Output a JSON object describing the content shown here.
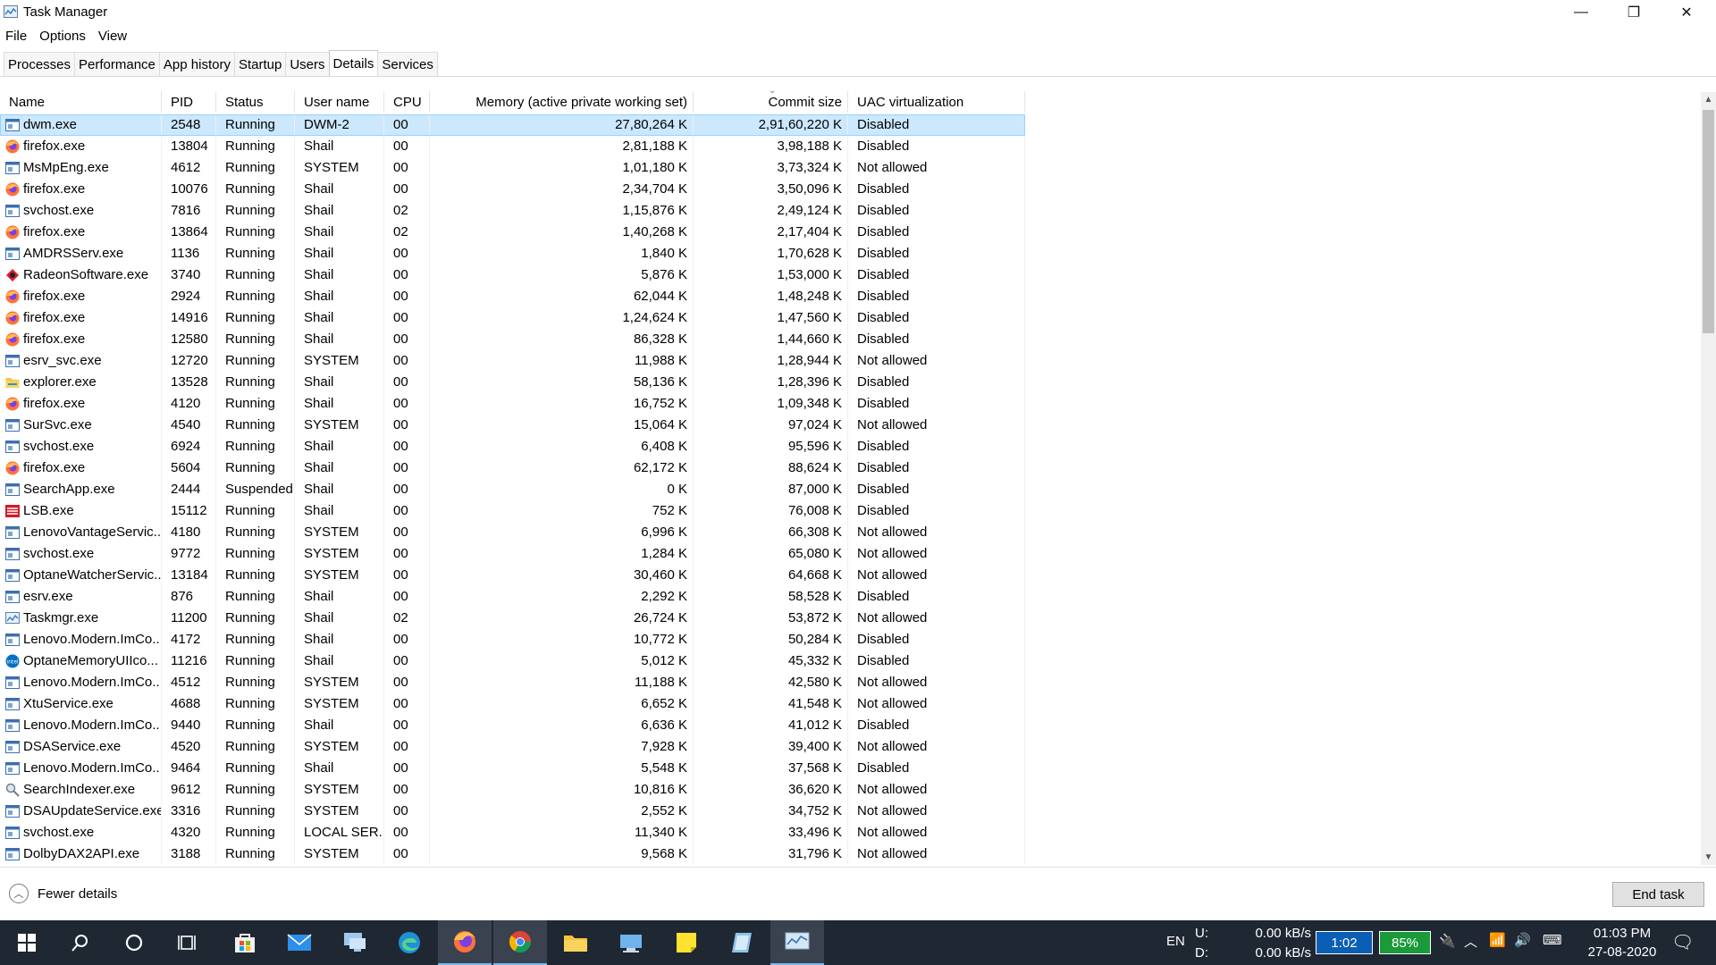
{
  "window": {
    "title": "Task Manager",
    "minimize": "—",
    "restore": "❐",
    "close": "✕"
  },
  "menu": [
    "File",
    "Options",
    "View"
  ],
  "tabs": [
    {
      "label": "Processes",
      "active": false
    },
    {
      "label": "Performance",
      "active": false
    },
    {
      "label": "App history",
      "active": false
    },
    {
      "label": "Startup",
      "active": false
    },
    {
      "label": "Users",
      "active": false
    },
    {
      "label": "Details",
      "active": true
    },
    {
      "label": "Services",
      "active": false
    }
  ],
  "columns": {
    "name": "Name",
    "pid": "PID",
    "status": "Status",
    "user": "User name",
    "cpu": "CPU",
    "memory": "Memory (active private working set)",
    "commit": "Commit size",
    "uac": "UAC virtualization"
  },
  "rows": [
    {
      "name": "dwm.exe",
      "icon": "generic",
      "pid": "2548",
      "status": "Running",
      "user": "DWM-2",
      "cpu": "00",
      "memory": "27,80,264 K",
      "commit": "2,91,60,220 K",
      "uac": "Disabled",
      "selected": true
    },
    {
      "name": "firefox.exe",
      "icon": "firefox",
      "pid": "13804",
      "status": "Running",
      "user": "Shail",
      "cpu": "00",
      "memory": "2,81,188 K",
      "commit": "3,98,188 K",
      "uac": "Disabled"
    },
    {
      "name": "MsMpEng.exe",
      "icon": "generic",
      "pid": "4612",
      "status": "Running",
      "user": "SYSTEM",
      "cpu": "00",
      "memory": "1,01,180 K",
      "commit": "3,73,324 K",
      "uac": "Not allowed"
    },
    {
      "name": "firefox.exe",
      "icon": "firefox",
      "pid": "10076",
      "status": "Running",
      "user": "Shail",
      "cpu": "00",
      "memory": "2,34,704 K",
      "commit": "3,50,096 K",
      "uac": "Disabled"
    },
    {
      "name": "svchost.exe",
      "icon": "generic",
      "pid": "7816",
      "status": "Running",
      "user": "Shail",
      "cpu": "02",
      "memory": "1,15,876 K",
      "commit": "2,49,124 K",
      "uac": "Disabled"
    },
    {
      "name": "firefox.exe",
      "icon": "firefox",
      "pid": "13864",
      "status": "Running",
      "user": "Shail",
      "cpu": "02",
      "memory": "1,40,268 K",
      "commit": "2,17,404 K",
      "uac": "Disabled"
    },
    {
      "name": "AMDRSServ.exe",
      "icon": "generic",
      "pid": "1136",
      "status": "Running",
      "user": "Shail",
      "cpu": "00",
      "memory": "1,840 K",
      "commit": "1,70,628 K",
      "uac": "Disabled"
    },
    {
      "name": "RadeonSoftware.exe",
      "icon": "radeon",
      "pid": "3740",
      "status": "Running",
      "user": "Shail",
      "cpu": "00",
      "memory": "5,876 K",
      "commit": "1,53,000 K",
      "uac": "Disabled"
    },
    {
      "name": "firefox.exe",
      "icon": "firefox",
      "pid": "2924",
      "status": "Running",
      "user": "Shail",
      "cpu": "00",
      "memory": "62,044 K",
      "commit": "1,48,248 K",
      "uac": "Disabled"
    },
    {
      "name": "firefox.exe",
      "icon": "firefox",
      "pid": "14916",
      "status": "Running",
      "user": "Shail",
      "cpu": "00",
      "memory": "1,24,624 K",
      "commit": "1,47,560 K",
      "uac": "Disabled"
    },
    {
      "name": "firefox.exe",
      "icon": "firefox",
      "pid": "12580",
      "status": "Running",
      "user": "Shail",
      "cpu": "00",
      "memory": "86,328 K",
      "commit": "1,44,660 K",
      "uac": "Disabled"
    },
    {
      "name": "esrv_svc.exe",
      "icon": "generic",
      "pid": "12720",
      "status": "Running",
      "user": "SYSTEM",
      "cpu": "00",
      "memory": "11,988 K",
      "commit": "1,28,944 K",
      "uac": "Not allowed"
    },
    {
      "name": "explorer.exe",
      "icon": "explorer",
      "pid": "13528",
      "status": "Running",
      "user": "Shail",
      "cpu": "00",
      "memory": "58,136 K",
      "commit": "1,28,396 K",
      "uac": "Disabled"
    },
    {
      "name": "firefox.exe",
      "icon": "firefox",
      "pid": "4120",
      "status": "Running",
      "user": "Shail",
      "cpu": "00",
      "memory": "16,752 K",
      "commit": "1,09,348 K",
      "uac": "Disabled"
    },
    {
      "name": "SurSvc.exe",
      "icon": "generic",
      "pid": "4540",
      "status": "Running",
      "user": "SYSTEM",
      "cpu": "00",
      "memory": "15,064 K",
      "commit": "97,024 K",
      "uac": "Not allowed"
    },
    {
      "name": "svchost.exe",
      "icon": "generic",
      "pid": "6924",
      "status": "Running",
      "user": "Shail",
      "cpu": "00",
      "memory": "6,408 K",
      "commit": "95,596 K",
      "uac": "Disabled"
    },
    {
      "name": "firefox.exe",
      "icon": "firefox",
      "pid": "5604",
      "status": "Running",
      "user": "Shail",
      "cpu": "00",
      "memory": "62,172 K",
      "commit": "88,624 K",
      "uac": "Disabled"
    },
    {
      "name": "SearchApp.exe",
      "icon": "generic",
      "pid": "2444",
      "status": "Suspended",
      "user": "Shail",
      "cpu": "00",
      "memory": "0 K",
      "commit": "87,000 K",
      "uac": "Disabled"
    },
    {
      "name": "LSB.exe",
      "icon": "lsb",
      "pid": "15112",
      "status": "Running",
      "user": "Shail",
      "cpu": "00",
      "memory": "752 K",
      "commit": "76,008 K",
      "uac": "Disabled"
    },
    {
      "name": "LenovoVantageServic...",
      "icon": "generic",
      "pid": "4180",
      "status": "Running",
      "user": "SYSTEM",
      "cpu": "00",
      "memory": "6,996 K",
      "commit": "66,308 K",
      "uac": "Not allowed"
    },
    {
      "name": "svchost.exe",
      "icon": "generic",
      "pid": "9772",
      "status": "Running",
      "user": "SYSTEM",
      "cpu": "00",
      "memory": "1,284 K",
      "commit": "65,080 K",
      "uac": "Not allowed"
    },
    {
      "name": "OptaneWatcherServic...",
      "icon": "generic",
      "pid": "13184",
      "status": "Running",
      "user": "SYSTEM",
      "cpu": "00",
      "memory": "30,460 K",
      "commit": "64,668 K",
      "uac": "Not allowed"
    },
    {
      "name": "esrv.exe",
      "icon": "generic",
      "pid": "876",
      "status": "Running",
      "user": "Shail",
      "cpu": "00",
      "memory": "2,292 K",
      "commit": "58,528 K",
      "uac": "Disabled"
    },
    {
      "name": "Taskmgr.exe",
      "icon": "taskmgr",
      "pid": "11200",
      "status": "Running",
      "user": "Shail",
      "cpu": "02",
      "memory": "26,724 K",
      "commit": "53,872 K",
      "uac": "Not allowed"
    },
    {
      "name": "Lenovo.Modern.ImCo...",
      "icon": "generic",
      "pid": "4172",
      "status": "Running",
      "user": "Shail",
      "cpu": "00",
      "memory": "10,772 K",
      "commit": "50,284 K",
      "uac": "Disabled"
    },
    {
      "name": "OptaneMemoryUIIco...",
      "icon": "intel",
      "pid": "11216",
      "status": "Running",
      "user": "Shail",
      "cpu": "00",
      "memory": "5,012 K",
      "commit": "45,332 K",
      "uac": "Disabled"
    },
    {
      "name": "Lenovo.Modern.ImCo...",
      "icon": "generic",
      "pid": "4512",
      "status": "Running",
      "user": "SYSTEM",
      "cpu": "00",
      "memory": "11,188 K",
      "commit": "42,580 K",
      "uac": "Not allowed"
    },
    {
      "name": "XtuService.exe",
      "icon": "generic",
      "pid": "4688",
      "status": "Running",
      "user": "SYSTEM",
      "cpu": "00",
      "memory": "6,652 K",
      "commit": "41,548 K",
      "uac": "Not allowed"
    },
    {
      "name": "Lenovo.Modern.ImCo...",
      "icon": "generic",
      "pid": "9440",
      "status": "Running",
      "user": "Shail",
      "cpu": "00",
      "memory": "6,636 K",
      "commit": "41,012 K",
      "uac": "Disabled"
    },
    {
      "name": "DSAService.exe",
      "icon": "generic",
      "pid": "4520",
      "status": "Running",
      "user": "SYSTEM",
      "cpu": "00",
      "memory": "7,928 K",
      "commit": "39,400 K",
      "uac": "Not allowed"
    },
    {
      "name": "Lenovo.Modern.ImCo...",
      "icon": "generic",
      "pid": "9464",
      "status": "Running",
      "user": "Shail",
      "cpu": "00",
      "memory": "5,548 K",
      "commit": "37,568 K",
      "uac": "Disabled"
    },
    {
      "name": "SearchIndexer.exe",
      "icon": "indexer",
      "pid": "9612",
      "status": "Running",
      "user": "SYSTEM",
      "cpu": "00",
      "memory": "10,816 K",
      "commit": "36,620 K",
      "uac": "Not allowed"
    },
    {
      "name": "DSAUpdateService.exe",
      "icon": "generic",
      "pid": "3316",
      "status": "Running",
      "user": "SYSTEM",
      "cpu": "00",
      "memory": "2,552 K",
      "commit": "34,752 K",
      "uac": "Not allowed"
    },
    {
      "name": "svchost.exe",
      "icon": "generic",
      "pid": "4320",
      "status": "Running",
      "user": "LOCAL SER...",
      "cpu": "00",
      "memory": "11,340 K",
      "commit": "33,496 K",
      "uac": "Not allowed"
    },
    {
      "name": "DolbyDAX2API.exe",
      "icon": "generic",
      "pid": "3188",
      "status": "Running",
      "user": "SYSTEM",
      "cpu": "00",
      "memory": "9,568 K",
      "commit": "31,796 K",
      "uac": "Not allowed"
    }
  ],
  "footer": {
    "fewer_details": "Fewer details",
    "end_task": "End task"
  },
  "taskbar": {
    "language": "EN",
    "upload_label": "U:",
    "download_label": "D:",
    "upload_speed": "0.00 kB/s",
    "download_speed": "0.00 kB/s",
    "timer": "1:02",
    "battery": "85%",
    "time": "01:03 PM",
    "date": "27-08-2020"
  },
  "colors": {
    "selection": "#cce8ff",
    "taskbar": "#1f2733",
    "timer_bg": "#0a5fb4",
    "battery_bg": "#1a9a3a"
  }
}
